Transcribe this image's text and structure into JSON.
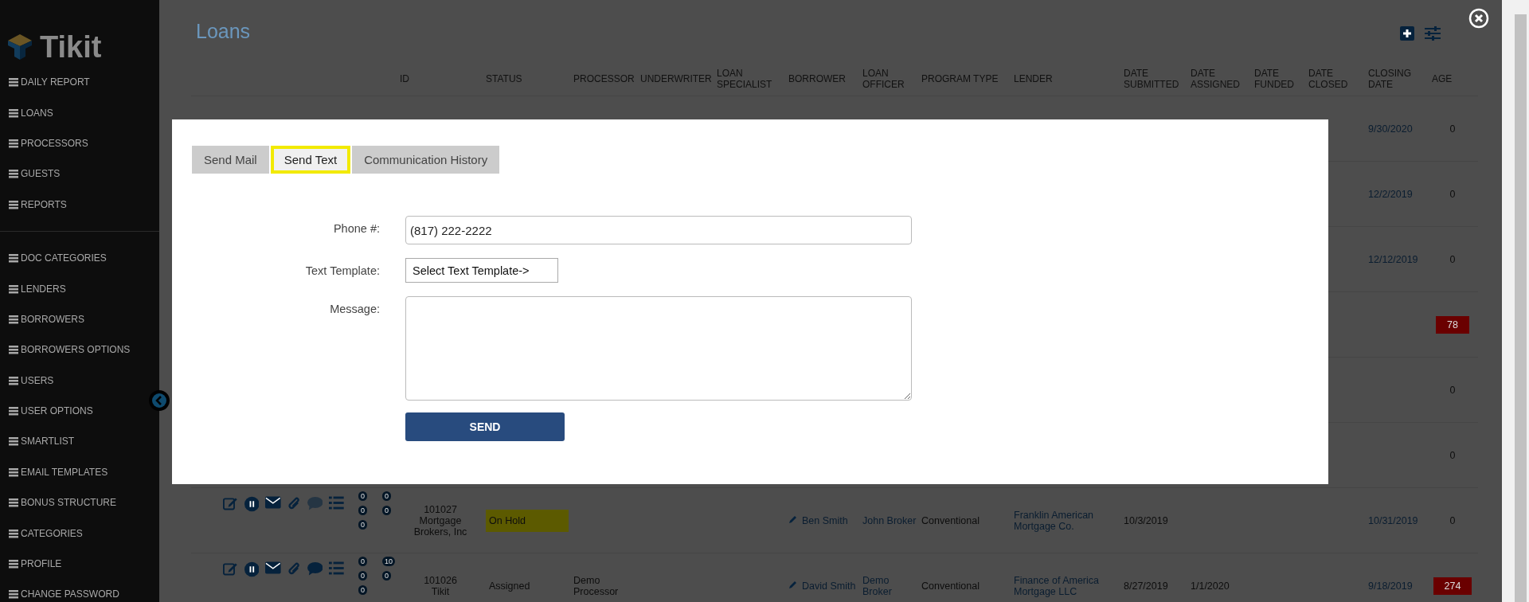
{
  "sidebar": {
    "logo": "Tikit",
    "groups": [
      [
        {
          "label": "DAILY REPORT"
        },
        {
          "label": "LOANS"
        },
        {
          "label": "PROCESSORS"
        },
        {
          "label": "GUESTS"
        },
        {
          "label": "REPORTS"
        }
      ],
      [
        {
          "label": "DOC CATEGORIES"
        },
        {
          "label": "LENDERS"
        },
        {
          "label": "BORROWERS"
        },
        {
          "label": "BORROWERS OPTIONS"
        },
        {
          "label": "USERS"
        },
        {
          "label": "USER OPTIONS"
        },
        {
          "label": "SMARTLIST"
        },
        {
          "label": "EMAIL TEMPLATES"
        },
        {
          "label": "BONUS STRUCTURE"
        },
        {
          "label": "CATEGORIES"
        },
        {
          "label": "PROFILE"
        },
        {
          "label": "CHANGE PASSWORD"
        }
      ]
    ]
  },
  "page": {
    "title": "Loans"
  },
  "table": {
    "columns": [
      "",
      "ID",
      "STATUS",
      "PROCESSOR",
      "UNDERWRITER",
      "LOAN SPECIALIST",
      "BORROWER",
      "LOAN OFFICER",
      "PROGRAM TYPE",
      "LENDER",
      "DATE SUBMITTED",
      "DATE ASSIGNED",
      "DATE FUNDED",
      "DATE CLOSED",
      "CLOSING DATE",
      "AGE"
    ],
    "rows": [
      {
        "kind": "hidden",
        "closing_date": "9/30/2020",
        "age": "0",
        "overdue": false
      },
      {
        "kind": "hidden",
        "closing_date": "12/2/2019",
        "age": "0",
        "overdue": false
      },
      {
        "kind": "hidden",
        "closing_date": "12/12/2019",
        "age": "0",
        "overdue": false
      },
      {
        "kind": "hidden",
        "age": "78",
        "overdue": true
      },
      {
        "kind": "hidden",
        "age": "0",
        "overdue": false
      },
      {
        "kind": "hidden",
        "age": "0",
        "overdue": false
      },
      {
        "kind": "full",
        "badges": [
          "0",
          "0",
          "0",
          "0",
          "0"
        ],
        "has_comments": false,
        "id": "101027",
        "company": "Mortgage Brokers, Inc",
        "status": "On Hold",
        "status_highlight": true,
        "borrower": "Ben Smith",
        "loan_officer": "John Broker",
        "program_type": "Conventional",
        "lender": "Franklin American Mortgage Co.",
        "date_submitted": "10/3/2019",
        "closing_date": "10/31/2019",
        "age": "0",
        "overdue": false
      },
      {
        "kind": "full",
        "badges": [
          "0",
          "10",
          "0",
          "0",
          "0"
        ],
        "has_comments": true,
        "id": "101026",
        "company": "Tikit",
        "status": "Assigned",
        "status_highlight": false,
        "processor": "Demo Processor",
        "borrower": "David Smith",
        "loan_officer": "Demo Broker",
        "program_type": "Conventional",
        "lender": "Finance of America Mortgage LLC",
        "date_submitted": "8/27/2019",
        "date_assigned": "1/1/2020",
        "closing_date": "9/18/2019",
        "age": "274",
        "overdue": true
      }
    ]
  },
  "modal": {
    "tabs": [
      {
        "label": "Send Mail",
        "selected": false
      },
      {
        "label": "Send Text",
        "selected": true
      },
      {
        "label": "Communication History",
        "selected": false
      }
    ],
    "fields": [
      {
        "kind": "input",
        "label": "Phone #:",
        "value": "(817) 222-2222"
      },
      {
        "kind": "select",
        "label": "Text Template:",
        "value": "Select Text Template->"
      },
      {
        "kind": "textarea",
        "label": "Message:"
      }
    ],
    "send_button": "SEND"
  }
}
